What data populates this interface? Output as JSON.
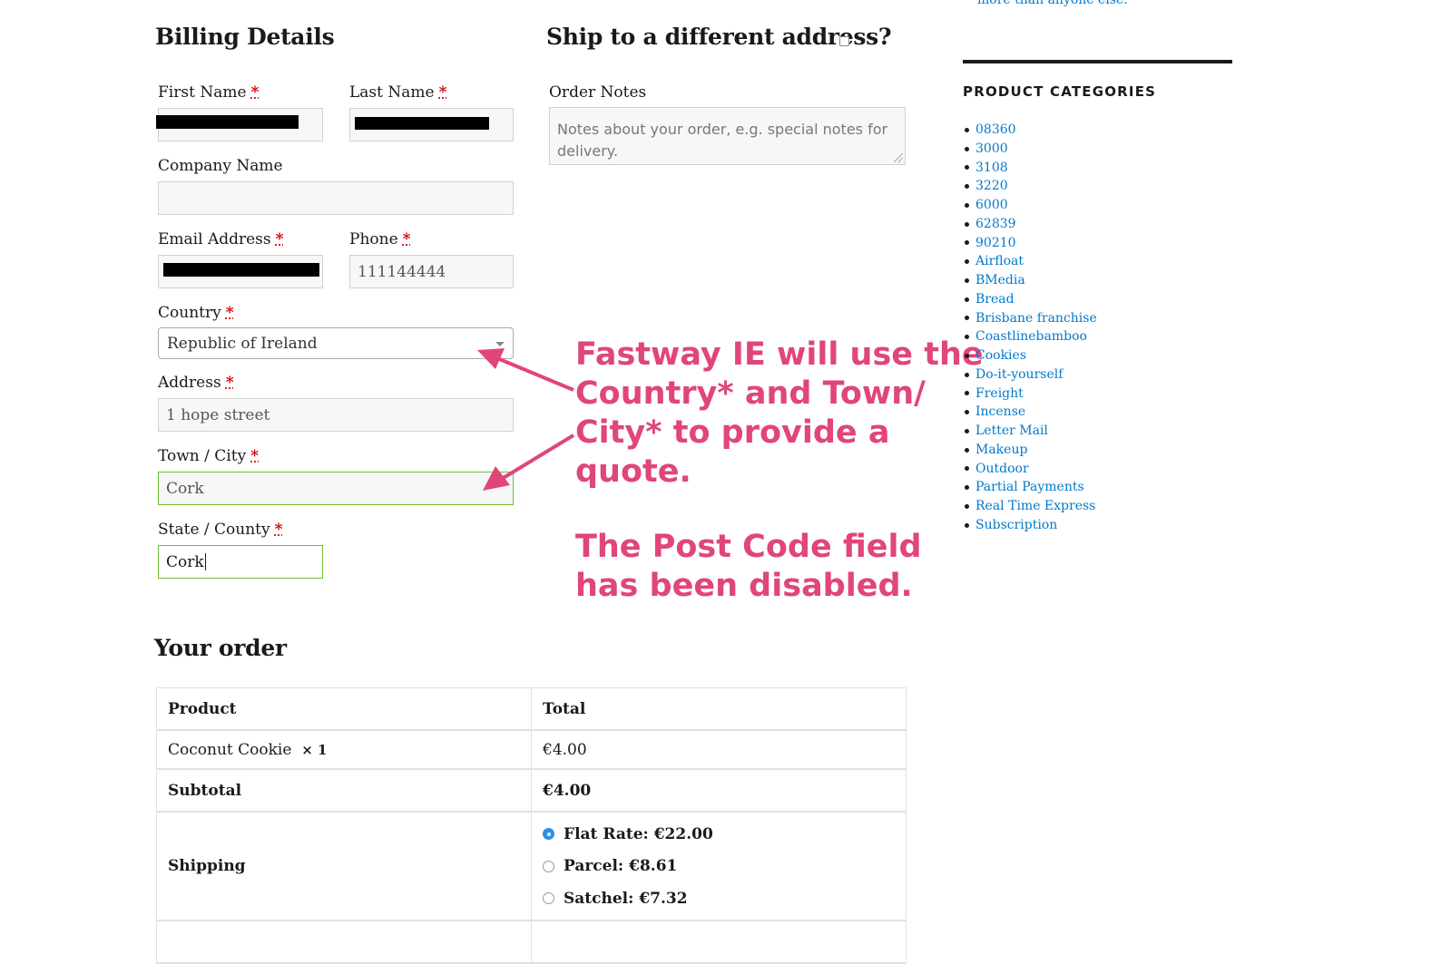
{
  "billing": {
    "title": "Billing Details",
    "first_name_label": "First Name",
    "last_name_label": "Last Name",
    "company_label": "Company Name",
    "company_value": "",
    "email_label": "Email Address",
    "phone_label": "Phone",
    "phone_value": "111144444",
    "country_label": "Country",
    "country_value": "Republic of Ireland",
    "address_label": "Address",
    "address_value": "1 hope street",
    "town_label": "Town / City",
    "town_value": "Cork",
    "state_label": "State / County",
    "state_value": "Cork",
    "required_mark": "*"
  },
  "shipping": {
    "title": "Ship to a different address?",
    "order_notes_label": "Order Notes",
    "order_notes_placeholder": "Notes about your order, e.g. special notes for delivery."
  },
  "annotation": {
    "line1": "Fastway IE will use the",
    "line2": "Country* and Town/",
    "line3": "City* to provide a",
    "line4": "quote.",
    "line5": "The Post Code field",
    "line6": "has been disabled.",
    "color": "#e0457b"
  },
  "sidebar": {
    "top_link": "more than anyone else.",
    "heading": "PRODUCT CATEGORIES",
    "categories": [
      "08360",
      "3000",
      "3108",
      "3220",
      "6000",
      "62839",
      "90210",
      "Airfloat",
      "BMedia",
      "Bread",
      "Brisbane franchise",
      "Coastlinebamboo",
      "Cookies",
      "Do-it-yourself",
      "Freight",
      "Incense",
      "Letter Mail",
      "Makeup",
      "Outdoor",
      "Partial Payments",
      "Real Time Express",
      "Subscription"
    ]
  },
  "order": {
    "title": "Your order",
    "col_product": "Product",
    "col_total": "Total",
    "item_name": "Coconut Cookie",
    "item_qty": "× 1",
    "item_total": "€4.00",
    "subtotal_label": "Subtotal",
    "subtotal_value": "€4.00",
    "shipping_label": "Shipping",
    "shipping_options": [
      {
        "label": "Flat Rate: €22.00",
        "checked": true
      },
      {
        "label": "Parcel: €8.61",
        "checked": false
      },
      {
        "label": "Satchel: €7.32",
        "checked": false
      }
    ]
  }
}
